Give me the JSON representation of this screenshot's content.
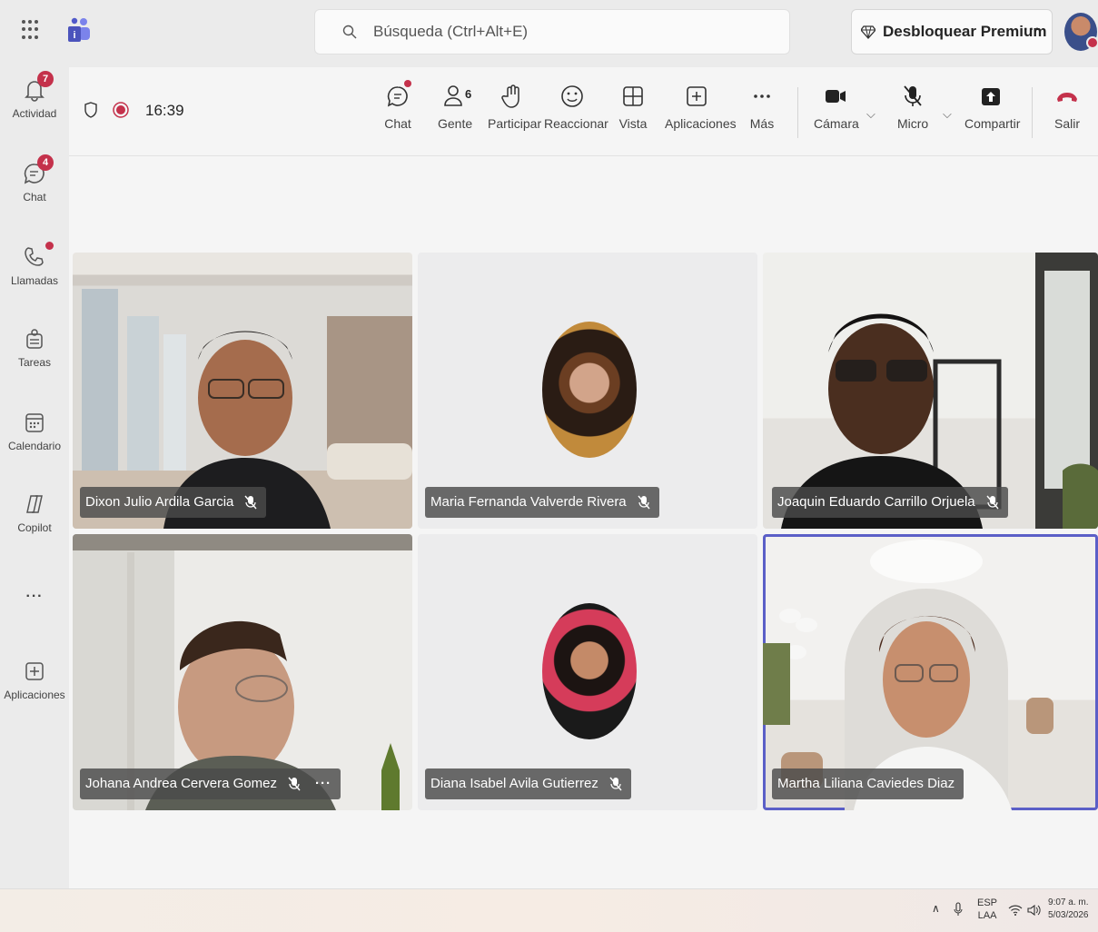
{
  "search": {
    "placeholder": "Búsqueda (Ctrl+Alt+E)"
  },
  "premium": {
    "label": "Desbloquear Premium",
    "more": "···"
  },
  "rail": {
    "items": [
      {
        "label": "Actividad",
        "badge": "7",
        "icon": "bell-icon"
      },
      {
        "label": "Chat",
        "badge": "4",
        "icon": "chat-icon"
      },
      {
        "label": "Llamadas",
        "icon": "phone-icon"
      },
      {
        "label": "Tareas",
        "icon": "tasks-icon"
      },
      {
        "label": "Calendario",
        "icon": "calendar-icon"
      },
      {
        "label": "Copilot",
        "icon": "copilot-icon"
      },
      {
        "label": "···",
        "icon": "more-icon"
      },
      {
        "label": "Aplicaciones",
        "icon": "add-apps-icon"
      }
    ]
  },
  "meeting": {
    "timer": "16:39",
    "toolbar": {
      "chat": "Chat",
      "people": "Gente",
      "people_count": "6",
      "raise": "Participar",
      "react": "Reaccionar",
      "view": "Vista",
      "apps": "Aplicaciones",
      "more": "Más",
      "camera": "Cámara",
      "mic": "Micro",
      "share": "Compartir",
      "leave": "Salir"
    }
  },
  "participants": [
    {
      "name": "Dixon Julio Ardila Garcia",
      "muted": true
    },
    {
      "name": "Maria Fernanda Valverde Rivera",
      "muted": true
    },
    {
      "name": "Joaquin Eduardo Carrillo Orjuela",
      "muted": true
    },
    {
      "name": "Johana Andrea Cervera Gomez",
      "muted": true,
      "more": "···"
    },
    {
      "name": "Diana Isabel Avila Gutierrez",
      "muted": true
    },
    {
      "name": "Martha Liliana Caviedes Diaz",
      "muted": false,
      "active_speaker": true
    }
  ],
  "taskbar": {
    "lang_top": "ESP",
    "lang_bottom": "LAA",
    "time": "9:07 a. m.",
    "date": "5/03/2026"
  },
  "colors": {
    "accent": "#5b5fc7",
    "leave": "#c4314b",
    "badge": "#c4314b"
  }
}
